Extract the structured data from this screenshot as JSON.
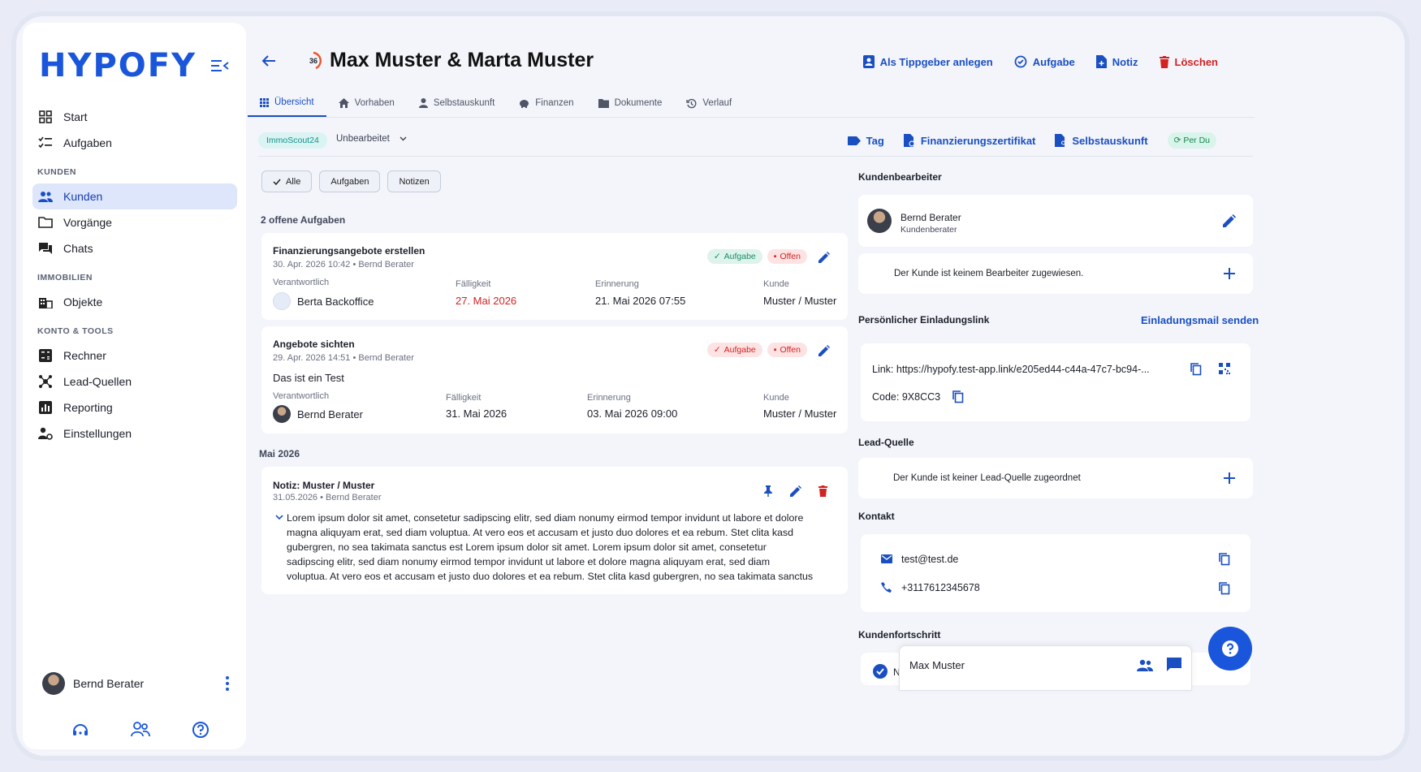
{
  "app": {
    "logo": "HYPOFY"
  },
  "sidebar": {
    "items_top": [
      {
        "label": "Start",
        "icon": "grid-icon"
      },
      {
        "label": "Aufgaben",
        "icon": "checklist-icon"
      }
    ],
    "section_kunden": "KUNDEN",
    "items_kunden": [
      {
        "label": "Kunden",
        "icon": "people-icon",
        "active": true
      },
      {
        "label": "Vorgänge",
        "icon": "folder-icon"
      },
      {
        "label": "Chats",
        "icon": "chat-icon"
      }
    ],
    "section_immobilien": "IMMOBILIEN",
    "items_immobilien": [
      {
        "label": "Objekte",
        "icon": "building-icon"
      }
    ],
    "section_tools": "KONTO & TOOLS",
    "items_tools": [
      {
        "label": "Rechner",
        "icon": "calculator-icon"
      },
      {
        "label": "Lead-Quellen",
        "icon": "hub-icon"
      },
      {
        "label": "Reporting",
        "icon": "chart-icon"
      },
      {
        "label": "Einstellungen",
        "icon": "user-settings-icon"
      }
    ],
    "user_name": "Bernd Berater"
  },
  "header": {
    "score": "36",
    "title": "Max Muster & Marta Muster",
    "actions": {
      "tippgeber": "Als Tippgeber anlegen",
      "aufgabe": "Aufgabe",
      "notiz": "Notiz",
      "loeschen": "Löschen"
    }
  },
  "tabs": {
    "uebersicht": "Übersicht",
    "vorhaben": "Vorhaben",
    "selbstauskunft": "Selbstauskunft",
    "finanzen": "Finanzen",
    "dokumente": "Dokumente",
    "verlauf": "Verlauf"
  },
  "subheader": {
    "source_chip": "ImmoScout24",
    "status": "Unbearbeitet",
    "tag": "Tag",
    "zertifikat": "Finanzierungszertifikat",
    "selbstauskunft": "Selbstauskunft",
    "perdu": "Per Du"
  },
  "filters": {
    "alle": "Alle",
    "aufgaben": "Aufgaben",
    "notizen": "Notizen"
  },
  "tasks_heading": "2 offene Aufgaben",
  "labels": {
    "verantwortlich": "Verantwortlich",
    "faelligkeit": "Fälligkeit",
    "erinnerung": "Erinnerung",
    "kunde": "Kunde",
    "badge_aufgabe": "Aufgabe",
    "badge_offen": "Offen"
  },
  "tasks": [
    {
      "title": "Finanzierungsangebote erstellen",
      "meta": "30. Apr. 2026 10:42 • Bernd Berater",
      "verantwortlich": "Berta Backoffice",
      "faelligkeit": "27. Mai 2026",
      "erinnerung": "21. Mai 2026 07:55",
      "kunde": "Muster / Muster"
    },
    {
      "title": "Angebote sichten",
      "meta": "29. Apr. 2026 14:51 • Bernd Berater",
      "body": "Das ist ein Test",
      "verantwortlich": "Bernd Berater",
      "faelligkeit": "31. Mai 2026",
      "erinnerung": "03. Mai 2026 09:00",
      "kunde": "Muster / Muster"
    }
  ],
  "month_heading": "Mai 2026",
  "note": {
    "title": "Notiz: Muster / Muster",
    "meta": "31.05.2026 • Bernd Berater",
    "lines": [
      "Lorem ipsum dolor sit amet, consetetur sadipscing elitr, sed diam nonumy eirmod tempor invidunt ut labore et dolore",
      "magna aliquyam erat, sed diam voluptua. At vero eos et accusam et justo duo dolores et ea rebum. Stet clita kasd",
      "gubergren, no sea takimata sanctus est Lorem ipsum dolor sit amet. Lorem ipsum dolor sit amet, consetetur",
      "sadipscing elitr, sed diam nonumy eirmod tempor invidunt ut labore et dolore magna aliquyam erat, sed diam",
      "voluptua. At vero eos et accusam et justo duo dolores et ea rebum. Stet clita kasd gubergren, no sea takimata sanctus"
    ]
  },
  "right": {
    "bearbeiter_heading": "Kundenbearbeiter",
    "bearbeiter_name": "Bernd Berater",
    "bearbeiter_role": "Kundenberater",
    "no_bearbeiter": "Der Kunde ist keinem Bearbeiter zugewiesen.",
    "link_heading": "Persönlicher Einladungslink",
    "link_action": "Einladungsmail senden",
    "link_text": "Link: https://hypofy.test-app.link/e205ed44-c44a-47c7-bc94-...",
    "code_text": "Code: 9X8CC3",
    "lead_heading": "Lead-Quelle",
    "no_lead": "Der Kunde ist keiner Lead-Quelle zugeordnet",
    "kontakt_heading": "Kontakt",
    "email": "test@test.de",
    "phone": "+3117612345678",
    "progress_heading": "Kundenfortschritt",
    "progress_partial": "N"
  },
  "chat_popup": {
    "name": "Max Muster"
  },
  "colors": {
    "primary": "#1a56db",
    "danger": "#d32222",
    "success": "#1c8d64"
  }
}
